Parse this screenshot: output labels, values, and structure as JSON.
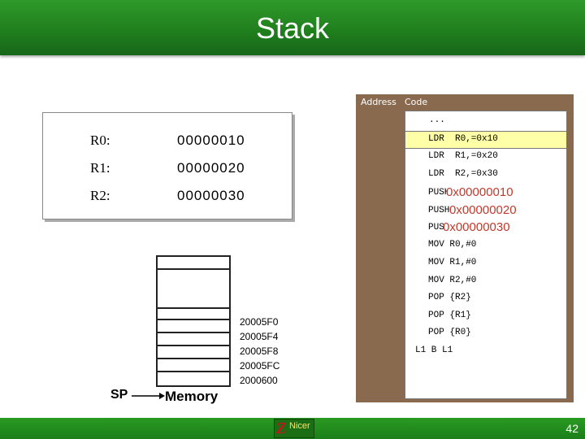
{
  "slide": {
    "title": "Stack",
    "page_number": "42"
  },
  "registers": [
    {
      "name": "R0:",
      "value": "00000010"
    },
    {
      "name": "R1:",
      "value": "00000020"
    },
    {
      "name": "R2:",
      "value": "00000030"
    }
  ],
  "code_panel": {
    "address_header": "Address",
    "code_header": "Code",
    "lines": [
      "...",
      "LDR  R0,=0x10",
      "LDR  R1,=0x20",
      "LDR  R2,=0x30",
      "MOV R0,#0",
      "MOV R1,#0",
      "MOV R2,#0",
      "POP {R2}",
      "POP {R1}",
      "POP {R0}",
      "L1 B L1"
    ],
    "push_lines": [
      {
        "tag": "PUSH",
        "value": "0x00000010"
      },
      {
        "tag": "PUSH",
        "value": "0x00000020"
      },
      {
        "tag": "PUSH",
        "value": "0x00000030"
      }
    ]
  },
  "stack": {
    "addresses": [
      "20005F0",
      "20005F4",
      "20005F8",
      "20005FC",
      "2000600"
    ],
    "sp_label": "SP",
    "memory_label": "Memory"
  },
  "footer": {
    "logo_letter": "Z",
    "logo_text": "Nicer"
  },
  "colors": {
    "title_green": "#1f7d1c",
    "code_frame_brown": "#8a6a4f",
    "highlight_yellow": "#ffffa8",
    "push_value_red": "#c0392b"
  }
}
